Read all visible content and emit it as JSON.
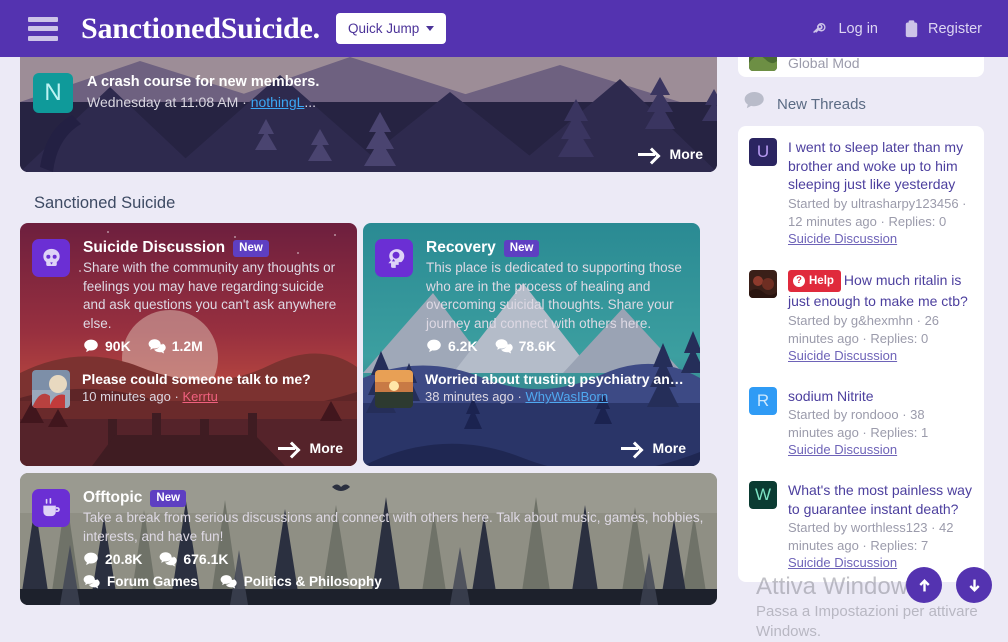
{
  "header": {
    "menu_icon": "hamburger-icon",
    "brand": "SanctionedSuicide.",
    "quick_jump": "Quick Jump",
    "login": "Log in",
    "login_icon": "key-icon",
    "register": "Register",
    "register_icon": "clipboard-icon"
  },
  "featured": {
    "avatar_letter": "N",
    "title": "A crash course for new members.",
    "time": "Wednesday at 11:08 AM · ",
    "author": "nothingL",
    "author_suffix": "...",
    "more": "More"
  },
  "main": {
    "section_title": "Sanctioned Suicide",
    "nodes": [
      {
        "name": "Suicide Discussion",
        "badge": "New",
        "icon": "skull-icon",
        "description": "Share with the community any thoughts or feelings you may have regarding suicide and ask questions you can't ask anywhere else.",
        "threads": "90K",
        "messages": "1.2M",
        "subnodes": [],
        "latest": {
          "title": "Please could someone talk to me?",
          "time": "10 minutes ago · ",
          "author": "Kerrtu"
        },
        "more": "More"
      },
      {
        "name": "Recovery",
        "badge": "New",
        "icon": "head-mind-icon",
        "description": "This place is dedicated to supporting those who are in the process of healing and overcoming suicidal thoughts. Share your journey and connect with others here.",
        "threads": "6.2K",
        "messages": "78.6K",
        "subnodes": [],
        "latest": {
          "title": "Worried about trusting psychiatry and trying t...",
          "time": "38 minutes ago · ",
          "author": "WhyWasIBorn"
        },
        "more": "More"
      },
      {
        "name": "Offtopic",
        "badge": "New",
        "icon": "coffee-cup-icon",
        "description": "Take a break from serious discussions and connect with others here. Talk about music, games, hobbies, interests, and have fun!",
        "threads": "20.8K",
        "messages": "676.1K",
        "subnodes": [
          "Forum Games",
          "Politics & Philosophy"
        ]
      }
    ]
  },
  "sidebar": {
    "staff_cut": "Global Mod",
    "new_threads_title": "New Threads",
    "new_threads_icon": "speech-bubble-icon",
    "threads": [
      {
        "avatar_letter": "U",
        "avatar_bg": "#2b2561",
        "avatar_fg": "#b79af2",
        "title": "I went to sleep later than my brother and woke up to him sleeping just like yesterday",
        "meta": "Started by ultrasharpy123456 · 12 minutes ago · Replies: 0",
        "node": "Suicide Discussion"
      },
      {
        "avatar_letter": "",
        "avatar_bg": "#3a1f18",
        "avatar_fg": "#b5604a",
        "badge": "Help",
        "title": "How much ritalin is just enough to make me ctb?",
        "meta": "Started by g&hexmhn · 26 minutes ago · Replies: 0",
        "node": "Suicide Discussion"
      },
      {
        "avatar_letter": "R",
        "avatar_bg": "#2f9bf5",
        "avatar_fg": "#cde8fd",
        "title": "sodium Nitrite",
        "meta": "Started by rondooo · 38 minutes ago · Replies: 1",
        "node": "Suicide Discussion"
      },
      {
        "avatar_letter": "W",
        "avatar_bg": "#0b3b32",
        "avatar_fg": "#7de3c4",
        "title": "What's the most painless way to guarantee instant death?",
        "meta": "Started by worthless123 · 42 minutes ago · Replies: 7",
        "node": "Suicide Discussion"
      }
    ]
  },
  "scroll": {
    "up_icon": "arrow-up-icon",
    "down_icon": "arrow-down-icon"
  },
  "watermark": {
    "line1": "Attiva Windows",
    "line2": "Passa a Impostazioni per attivare Windows."
  },
  "colors": {
    "brand": "#5433b0",
    "accent": "#6b2fd4",
    "help": "#e02a3c",
    "page_bg": "#eceaf6"
  }
}
